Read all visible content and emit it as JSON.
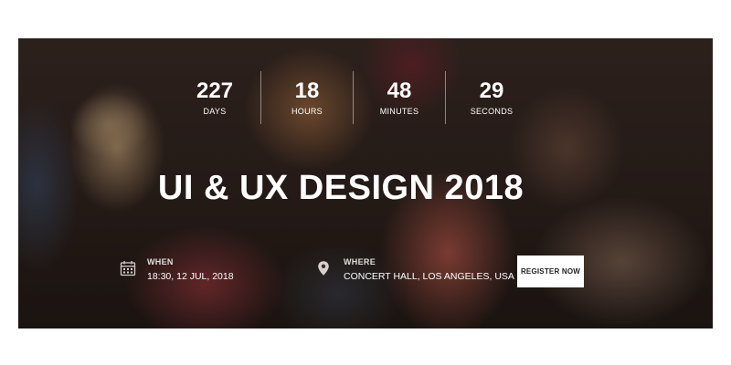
{
  "countdown": [
    {
      "value": "227",
      "unit": "DAYS"
    },
    {
      "value": "18",
      "unit": "HOURS"
    },
    {
      "value": "48",
      "unit": "MINUTES"
    },
    {
      "value": "29",
      "unit": "SECONDS"
    }
  ],
  "event": {
    "title": "UI & UX DESIGN 2018",
    "when_label": "WHEN",
    "when_value": "18:30, 12 JUL, 2018",
    "where_label": "WHERE",
    "where_value": "CONCERT HALL, LOS ANGELES, USA"
  },
  "cta": {
    "register_label": "REGISTER NOW"
  },
  "icons": {
    "when": "calendar-icon",
    "where": "map-pin-icon"
  },
  "colors": {
    "text": "#ffffff",
    "button_bg": "#ffffff",
    "button_text": "#222222"
  }
}
